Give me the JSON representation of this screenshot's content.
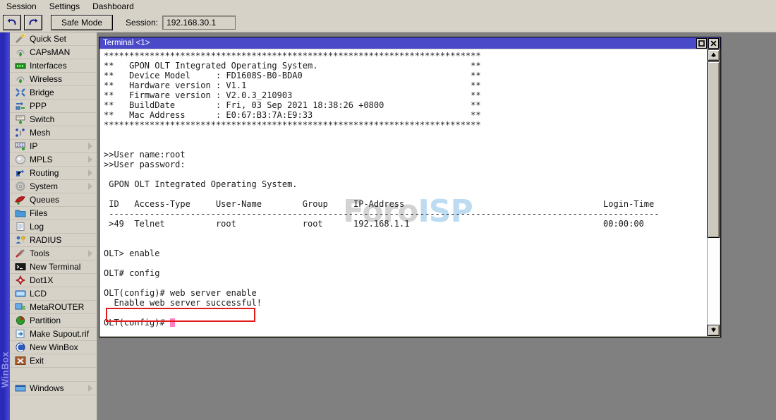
{
  "menubar": {
    "items": [
      {
        "label": "Session"
      },
      {
        "label": "Settings"
      },
      {
        "label": "Dashboard"
      }
    ]
  },
  "toolbar": {
    "undo_icon": "undo-arrow-icon",
    "redo_icon": "redo-arrow-icon",
    "safe_mode_label": "Safe Mode",
    "session_label": "Session:",
    "session_value": "192.168.30.1"
  },
  "branding": {
    "vertical_label": "WinBox"
  },
  "sidebar": {
    "items": [
      {
        "label": "Quick Set",
        "icon": "magic-wand-icon",
        "submenu": false
      },
      {
        "label": "CAPsMAN",
        "icon": "antenna-icon",
        "submenu": false
      },
      {
        "label": "Interfaces",
        "icon": "network-card-icon",
        "submenu": false
      },
      {
        "label": "Wireless",
        "icon": "antenna-icon",
        "submenu": false
      },
      {
        "label": "Bridge",
        "icon": "bridge-arrows-icon",
        "submenu": false
      },
      {
        "label": "PPP",
        "icon": "ppp-link-icon",
        "submenu": false
      },
      {
        "label": "Switch",
        "icon": "switch-icon",
        "submenu": false
      },
      {
        "label": "Mesh",
        "icon": "mesh-nodes-icon",
        "submenu": false
      },
      {
        "label": "IP",
        "icon": "ip-255-icon",
        "submenu": true
      },
      {
        "label": "MPLS",
        "icon": "mpls-disc-icon",
        "submenu": true
      },
      {
        "label": "Routing",
        "icon": "routing-arrows-icon",
        "submenu": true
      },
      {
        "label": "System",
        "icon": "gear-icon",
        "submenu": true
      },
      {
        "label": "Queues",
        "icon": "queues-icon",
        "submenu": false
      },
      {
        "label": "Files",
        "icon": "folder-icon",
        "submenu": false
      },
      {
        "label": "Log",
        "icon": "log-list-icon",
        "submenu": false
      },
      {
        "label": "RADIUS",
        "icon": "user-key-icon",
        "submenu": false
      },
      {
        "label": "Tools",
        "icon": "tools-wrench-icon",
        "submenu": true
      },
      {
        "label": "New Terminal",
        "icon": "terminal-icon",
        "submenu": false
      },
      {
        "label": "Dot1X",
        "icon": "dot1x-icon",
        "submenu": false
      },
      {
        "label": "LCD",
        "icon": "lcd-screen-icon",
        "submenu": false
      },
      {
        "label": "MetaROUTER",
        "icon": "metarouter-icon",
        "submenu": false
      },
      {
        "label": "Partition",
        "icon": "partition-pie-icon",
        "submenu": false
      },
      {
        "label": "Make Supout.rif",
        "icon": "supout-icon",
        "submenu": false
      },
      {
        "label": "New WinBox",
        "icon": "winbox-swirl-icon",
        "submenu": false
      },
      {
        "label": "Exit",
        "icon": "exit-icon",
        "submenu": false
      }
    ],
    "footer": {
      "label": "Windows",
      "icon": "window-icon",
      "submenu": true
    }
  },
  "terminal": {
    "title": "Terminal <1>",
    "maximize_icon": "maximize-icon",
    "close_icon": "close-icon",
    "banner": {
      "rule": "**************************************************************************",
      "lines": [
        {
          "label": "",
          "value": "GPON OLT Integrated Operating System."
        },
        {
          "label": "Device Model",
          "value": "FD1608S-B0-BDA0"
        },
        {
          "label": "Hardware version",
          "value": "V1.1"
        },
        {
          "label": "Firmware version",
          "value": "V2.0.3_210903"
        },
        {
          "label": "BuildDate",
          "value": "Fri, 03 Sep 2021 18:38:26 +0800"
        },
        {
          "label": "Mac Address",
          "value": "E0:67:B3:7A:E9:33"
        }
      ]
    },
    "login": {
      "user_prompt": ">>User name:root",
      "password_prompt": ">>User password:",
      "welcome": " GPON OLT Integrated Operating System."
    },
    "session_table": {
      "headers": [
        "ID",
        "Access-Type",
        "User-Name",
        "Group",
        "IP-Address",
        "Login-Time"
      ],
      "divider": "----------------------------------------------------------------------------------------------------------------",
      "rows": [
        {
          "id": ">49",
          "access_type": "Telnet",
          "user_name": "root",
          "group": "root",
          "ip_address": "192.168.1.1",
          "login_time": "00:00:00"
        }
      ]
    },
    "commands": [
      {
        "prompt": "OLT> ",
        "command": "enable"
      },
      {
        "prompt": "OLT# ",
        "command": "config"
      },
      {
        "prompt": "OLT(config)# ",
        "command": "web server enable"
      }
    ],
    "output_highlighted": "  Enable web server successful!",
    "final_prompt": "OLT(config)# ",
    "screen_text": "**************************************************************************\n**   GPON OLT Integrated Operating System.                     **\n**   Device Model      : FD1608S-B0-BDA0                       **\n**   Hardware version  : V1.1                                  **\n**   Firmware version  : V2.0.3_210903                         **\n**   BuildDate         : Fri, 03 Sep 2021 18:38:26 +0800       **\n**   Mac Address       : E0:67:B3:7A:E9:33                     **\n**************************************************************************\n\n\n>>User name:root\n>>User password:\n\n GPON OLT Integrated Operating System.\n\n ID  Access-Type     User-Name        Group     IP-Address                            Login-Time\n ----------------------------------------------------------------------------------------------------------\n >49  Telnet          root             root      192.168.1.1                           00:00:00\n\n\nOLT> enable\n\nOLT# config\n\nOLT(config)# web server enable\n  Enable web server successful!\n\nOLT(config)# "
  },
  "watermark": {
    "part1": "Foro",
    "part2": "ISP"
  },
  "scrollbar": {
    "up_icon": "scroll-up-icon",
    "down_icon": "scroll-down-icon"
  },
  "colors": {
    "title_bar": "#4a4ac8",
    "chrome": "#d6d2c8",
    "annotation": "#e01b1b",
    "cursor": "#ff7fc4",
    "desktop": "#808080"
  }
}
